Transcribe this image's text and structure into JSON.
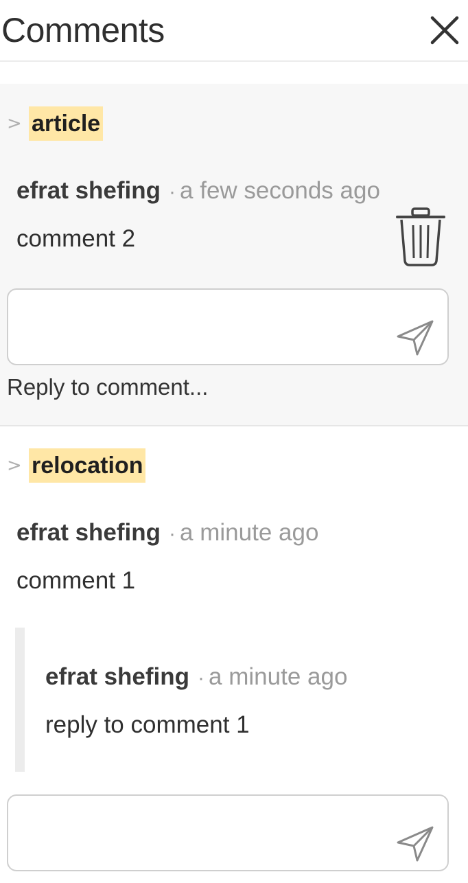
{
  "header": {
    "title": "Comments",
    "close_icon": "close-icon"
  },
  "threads": [
    {
      "anchor_text": "article",
      "chevron": ">",
      "comments": [
        {
          "author": "efrat shefing",
          "separator": "·",
          "time": "a few seconds ago",
          "text": "comment 2"
        }
      ],
      "reply_hint": "Reply to comment..."
    },
    {
      "anchor_text": "relocation",
      "chevron": ">",
      "comments": [
        {
          "author": "efrat shefing",
          "separator": "·",
          "time": "a minute ago",
          "text": "comment 1"
        },
        {
          "author": "efrat shefing",
          "separator": "·",
          "time": "a minute ago",
          "text": "reply to comment 1"
        }
      ]
    }
  ],
  "icons": {
    "delete": "trash-icon",
    "send": "send-icon",
    "collapse": "chevron-right-icon"
  },
  "colors": {
    "highlight": "#ffe7a6",
    "muted_text": "#9a9a9a",
    "active_thread_bg": "#f7f7f7"
  }
}
